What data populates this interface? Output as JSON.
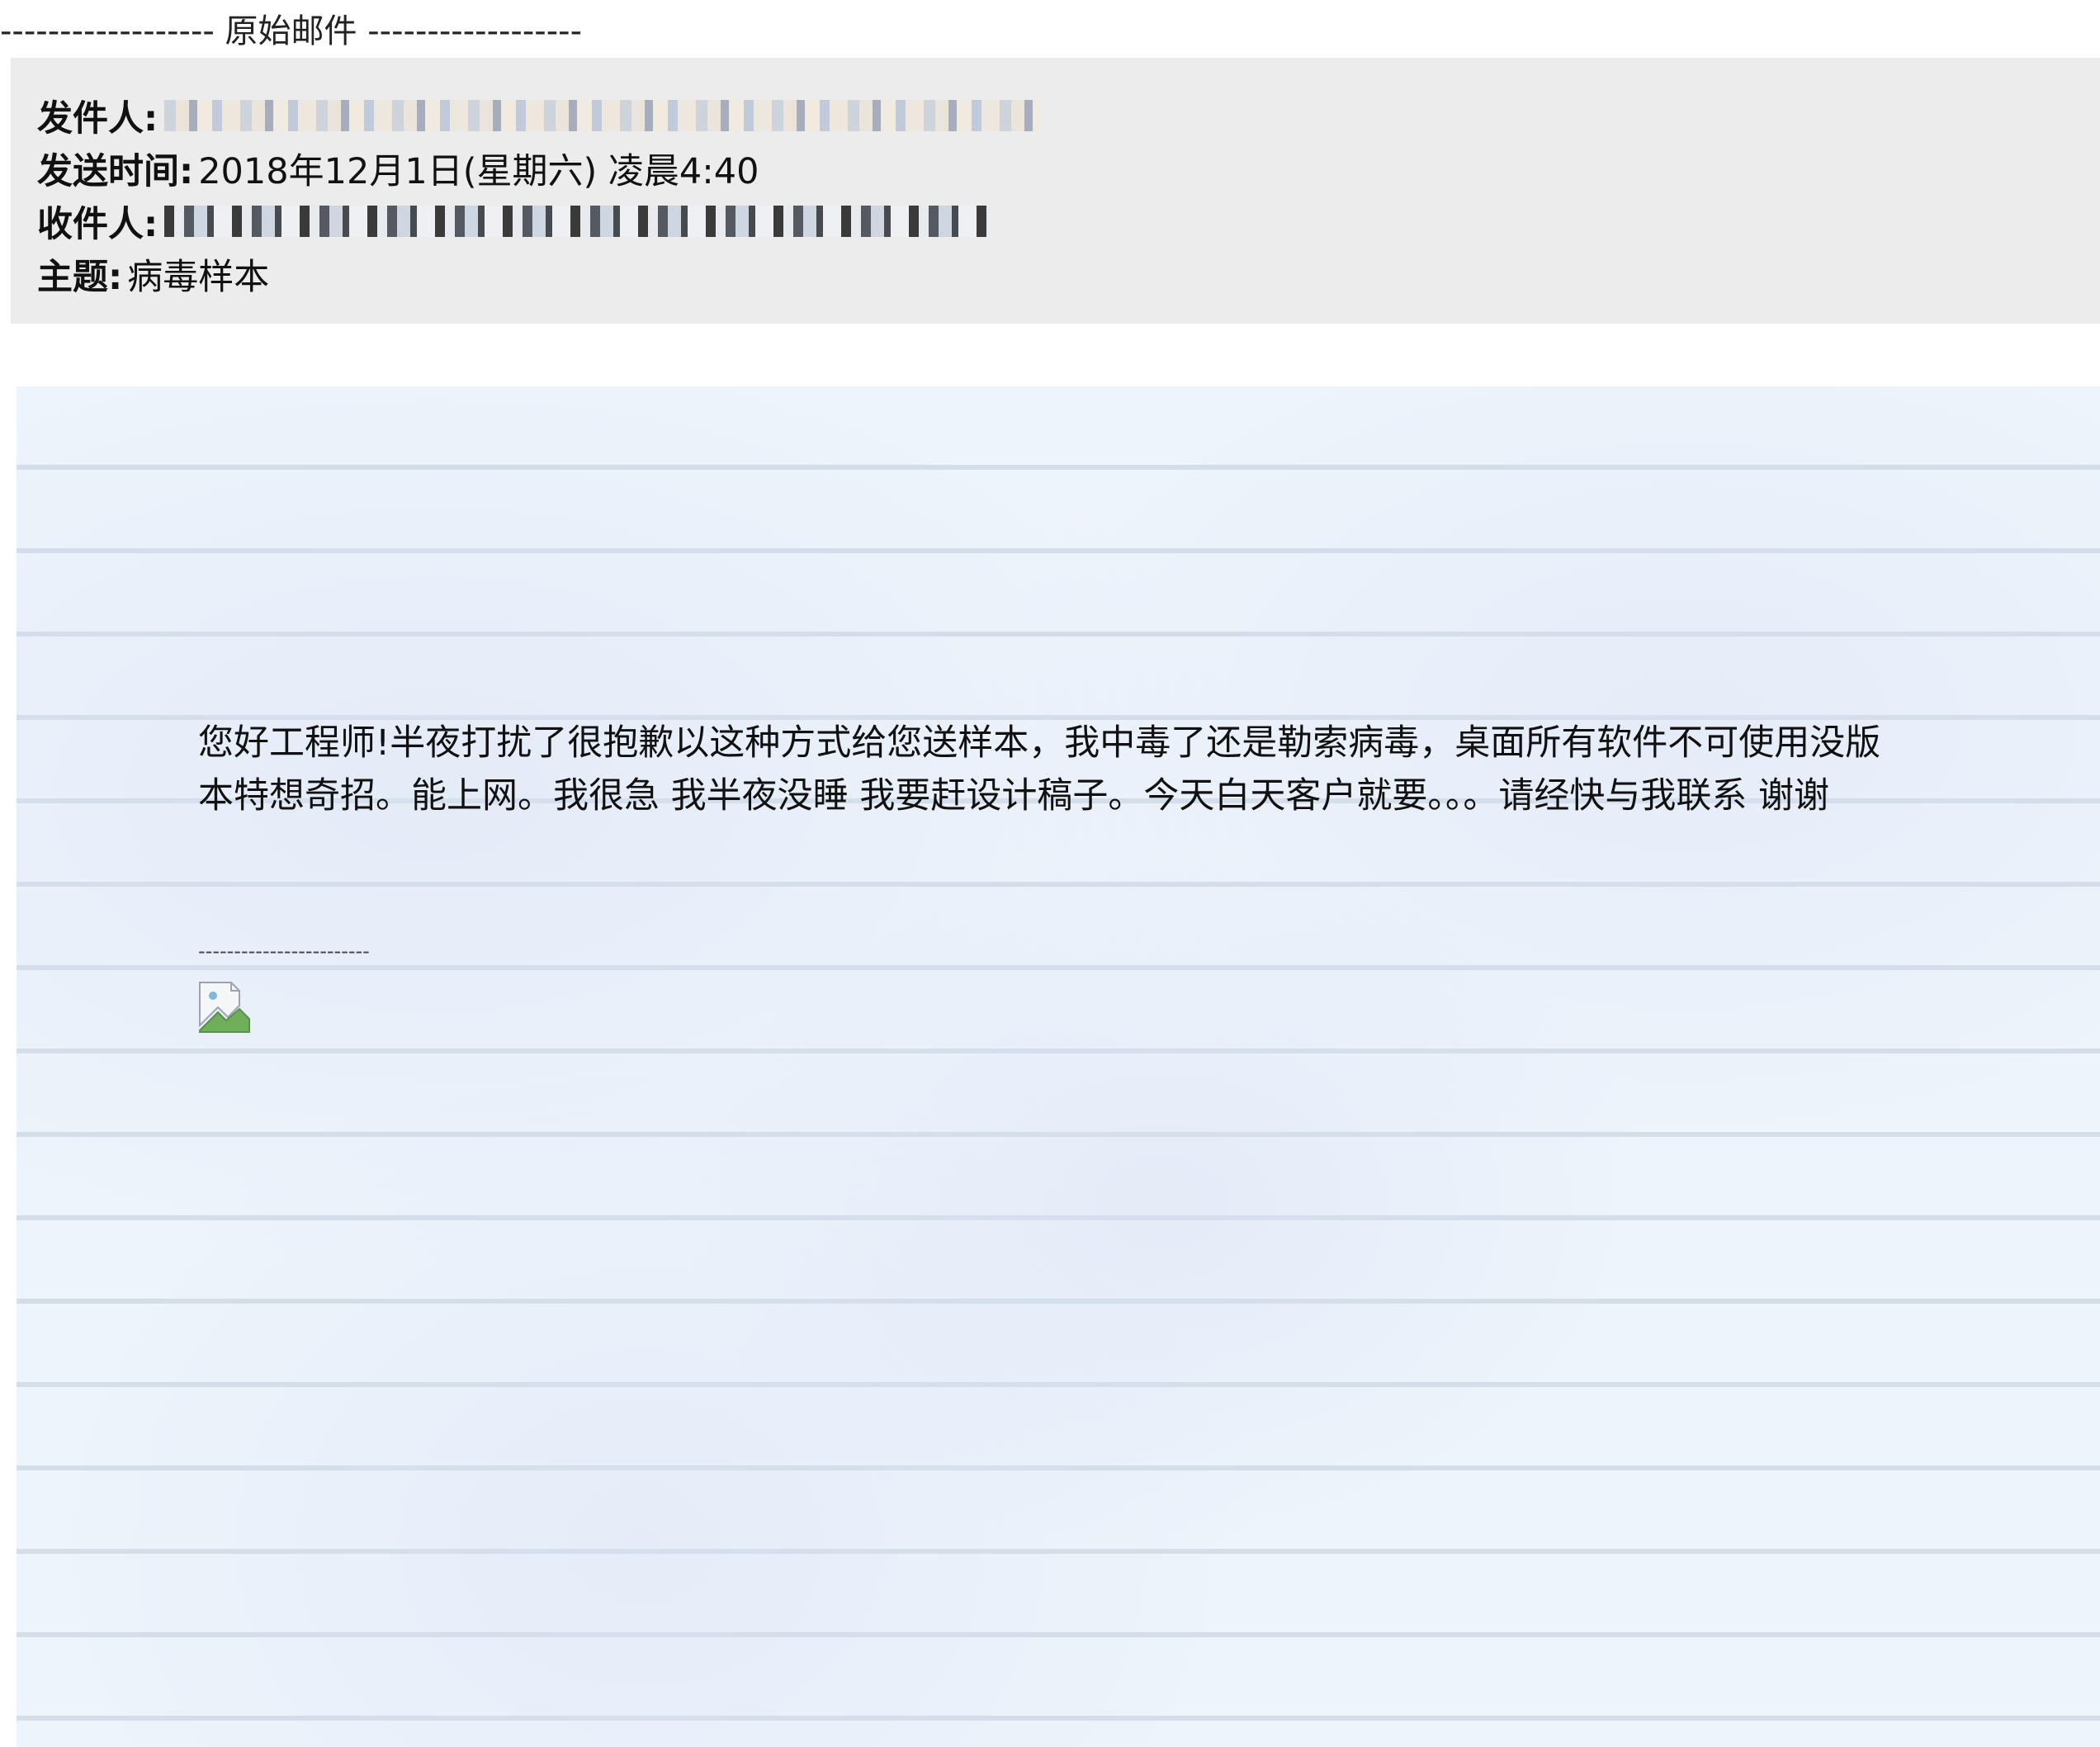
{
  "original_mail_divider": "------------------ 原始邮件 ------------------",
  "header": {
    "from_label": "发件人:",
    "sent_label": "发送时间:",
    "sent_value": "2018年12月1日(星期六) 凌晨4:40",
    "to_label": "收件人:",
    "subject_label": "主题:",
    "subject_value": "病毒样本"
  },
  "body": {
    "message": "您好工程师!半夜打扰了很抱歉以这种方式给您送样本，我中毒了还是勒索病毒，桌面所有软件不可使用没版本特想奇招。能上网。我很急  我半夜没睡 我要赶设计稿子。今天白天客户就要。。。请经快与我联系 谢谢",
    "signature_divider": "------------------------"
  }
}
